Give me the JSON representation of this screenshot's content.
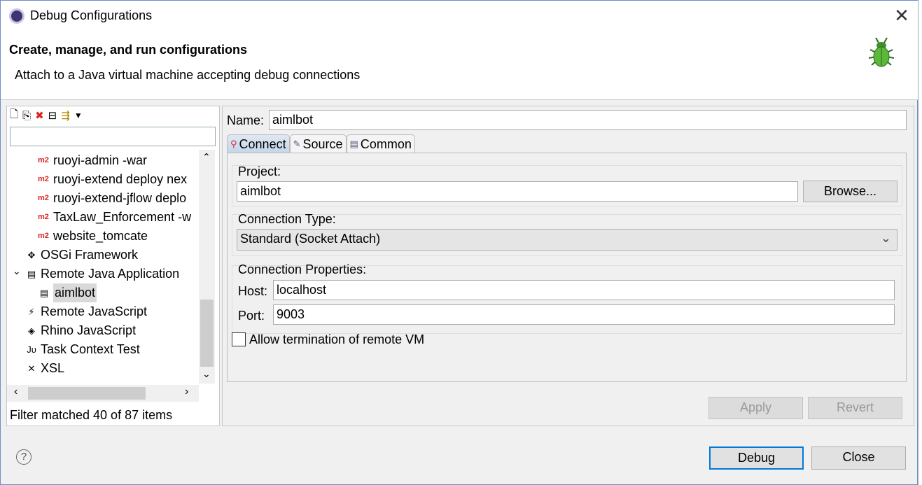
{
  "window": {
    "title": "Debug Configurations",
    "close_glyph": "✕"
  },
  "header": {
    "title": "Create, manage, and run configurations",
    "subtitle": "Attach to a Java virtual machine accepting debug connections"
  },
  "left": {
    "toolbar": [
      {
        "icon": "new-config-icon",
        "glyph": "🗋"
      },
      {
        "icon": "duplicate-icon",
        "glyph": "⎘"
      },
      {
        "icon": "delete-icon",
        "glyph": "✖"
      },
      {
        "icon": "collapse-all-icon",
        "glyph": "⊟"
      },
      {
        "icon": "filter-icon",
        "glyph": "⇶"
      },
      {
        "icon": "dropdown-icon",
        "glyph": "▼"
      }
    ],
    "filter_value": "",
    "tree": [
      {
        "label": "ruoyi-admin -war",
        "icon": "m2",
        "indent": 2
      },
      {
        "label": "ruoyi-extend deploy nex",
        "icon": "m2",
        "indent": 2
      },
      {
        "label": "ruoyi-extend-jflow deplo",
        "icon": "m2",
        "indent": 2
      },
      {
        "label": "TaxLaw_Enforcement -w",
        "icon": "m2",
        "indent": 2
      },
      {
        "label": "website_tomcate",
        "icon": "m2",
        "indent": 2
      },
      {
        "label": "OSGi Framework",
        "icon": "✥",
        "indent": 1
      },
      {
        "label": "Remote Java Application",
        "icon": "▤",
        "indent": 1,
        "expanded": true
      },
      {
        "label": "aimlbot",
        "icon": "▤",
        "indent": 2,
        "selected": true
      },
      {
        "label": "Remote JavaScript",
        "icon": "⚡",
        "indent": 1
      },
      {
        "label": "Rhino JavaScript",
        "icon": "◈",
        "indent": 1
      },
      {
        "label": "Task Context Test",
        "icon": "Jυ",
        "indent": 1
      },
      {
        "label": "XSL",
        "icon": "✕",
        "indent": 1
      }
    ],
    "status": "Filter matched 40 of 87 items"
  },
  "form": {
    "name_label": "Name:",
    "name_value": "aimlbot",
    "tabs": [
      {
        "label": "Connect",
        "icon": "connect-icon",
        "glyph": "⚲",
        "selected": true
      },
      {
        "label": "Source",
        "icon": "source-icon",
        "glyph": "✎"
      },
      {
        "label": "Common",
        "icon": "common-icon",
        "glyph": "▤"
      }
    ],
    "project_label": "Project:",
    "project_value": "aimlbot",
    "browse": "Browse...",
    "conn_type_label": "Connection Type:",
    "conn_type_value": "Standard (Socket Attach)",
    "conn_props_label": "Connection Properties:",
    "host_label": "Host:",
    "host_value": "localhost",
    "port_label": "Port:",
    "port_value": "9003",
    "allow_term_label": "Allow termination of remote VM",
    "allow_term_checked": false,
    "apply": "Apply",
    "revert": "Revert"
  },
  "footer": {
    "help": "?",
    "debug": "Debug",
    "close": "Close"
  }
}
